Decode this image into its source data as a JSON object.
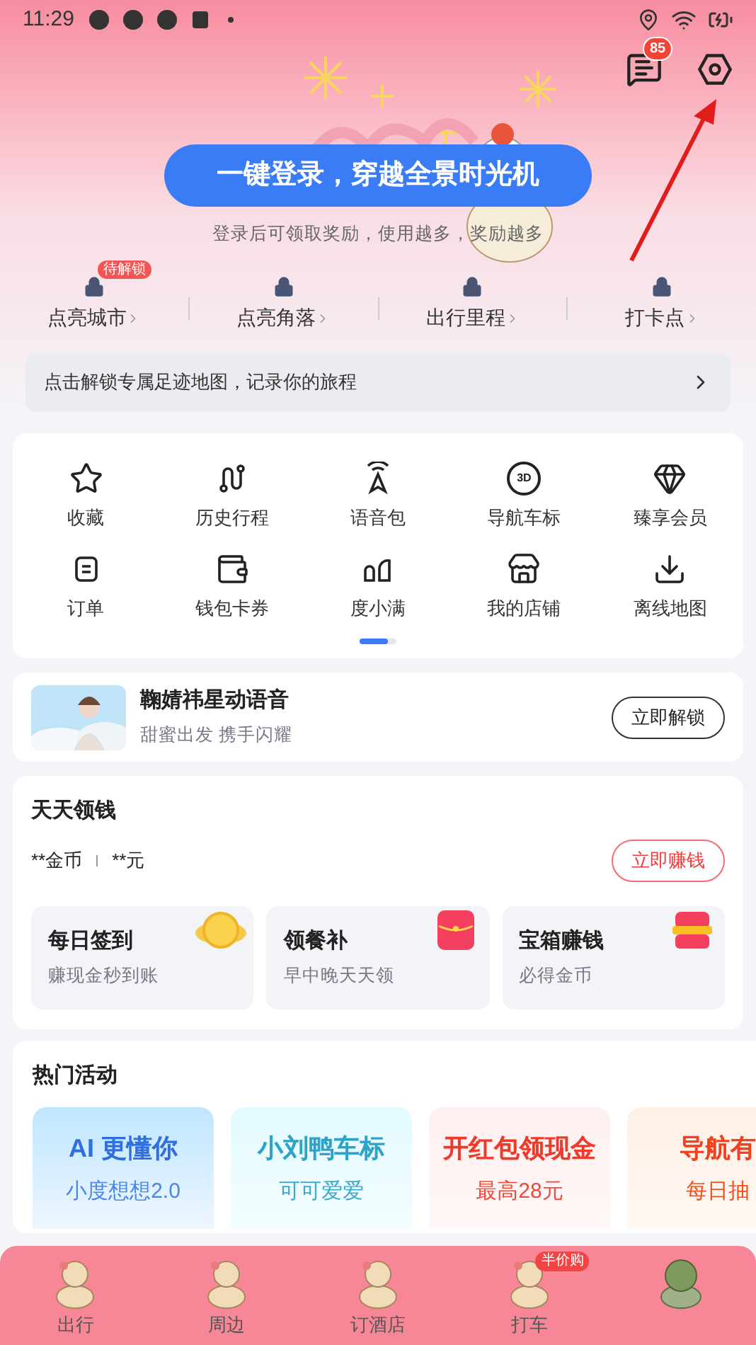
{
  "status_bar": {
    "time": "11:29"
  },
  "header": {
    "message_badge": "85",
    "login_button": "一键登录，穿越全景时光机",
    "subtitle": "登录后可领取奖励，使用越多，奖励越多"
  },
  "unlock_items": [
    {
      "label": "点亮城市",
      "badge": "待解锁"
    },
    {
      "label": "点亮角落"
    },
    {
      "label": "出行里程"
    },
    {
      "label": "打卡点"
    }
  ],
  "footprint_banner": "点击解锁专属足迹地图，记录你的旅程",
  "shortcuts": [
    {
      "label": "收藏",
      "kind": "star"
    },
    {
      "label": "历史行程",
      "kind": "route"
    },
    {
      "label": "语音包",
      "kind": "voice"
    },
    {
      "label": "导航车标",
      "kind": "badge",
      "icon_text": "3D"
    },
    {
      "label": "臻享会员",
      "kind": "gem"
    },
    {
      "label": "订单",
      "kind": "order"
    },
    {
      "label": "钱包卡券",
      "kind": "wallet"
    },
    {
      "label": "度小满",
      "kind": "leaves"
    },
    {
      "label": "我的店铺",
      "kind": "store"
    },
    {
      "label": "离线地图",
      "kind": "download"
    }
  ],
  "voice_pack": {
    "title": "鞠婧祎星动语音",
    "subtitle": "甜蜜出发 携手闪耀",
    "button": "立即解锁"
  },
  "daily_money": {
    "title": "天天领钱",
    "coins": "**金币",
    "cash": "**元",
    "button": "立即赚钱",
    "tasks": [
      {
        "title": "每日签到",
        "subtitle": "赚现金秒到账",
        "kind": "coin"
      },
      {
        "title": "领餐补",
        "subtitle": "早中晚天天领",
        "kind": "envelope"
      },
      {
        "title": "宝箱赚钱",
        "subtitle": "必得金币",
        "kind": "chest"
      }
    ]
  },
  "hot_activities": {
    "title": "热门活动",
    "cards": [
      {
        "title": "AI 更懂你",
        "subtitle": "小度想想2.0",
        "kind": "blue"
      },
      {
        "title": "小刘鸭车标",
        "subtitle": "可可爱爱",
        "kind": "cyan"
      },
      {
        "title": "开红包领现金",
        "subtitle": "最高28元",
        "kind": "red"
      },
      {
        "title": "导航有",
        "subtitle": "每日抽",
        "kind": "orange"
      }
    ]
  },
  "bottom_nav": [
    {
      "label": "出行",
      "kind": "tab"
    },
    {
      "label": "周边",
      "kind": "tab"
    },
    {
      "label": "订酒店",
      "kind": "tab"
    },
    {
      "label": "打车",
      "badge": "半价购",
      "kind": "tab"
    },
    {
      "kind": "icon"
    }
  ]
}
